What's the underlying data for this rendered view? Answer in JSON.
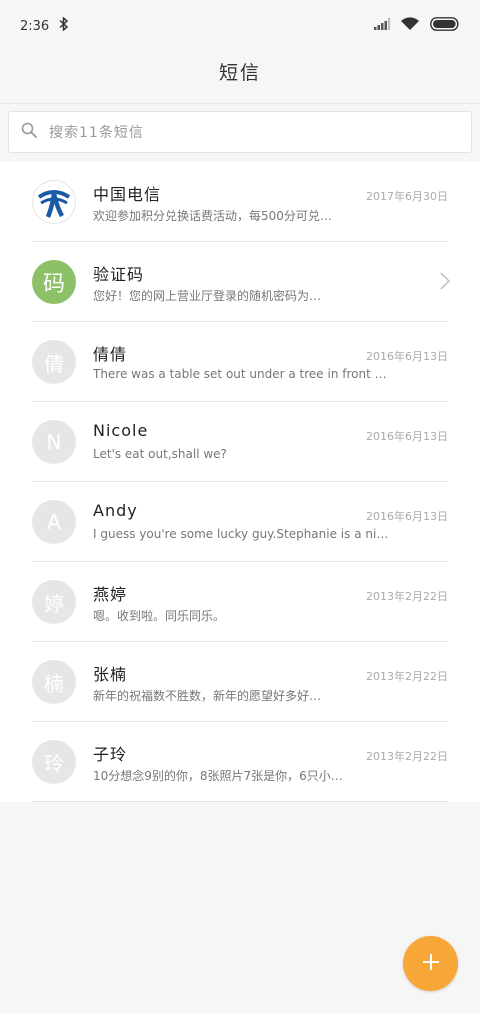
{
  "status_bar": {
    "time": "2:36"
  },
  "header": {
    "title": "短信"
  },
  "search": {
    "placeholder": "搜索11条短信"
  },
  "colors": {
    "accent": "#f7a737",
    "avatar_green": "#8cc167",
    "avatar_grey": "#e6e6e6"
  },
  "messages": [
    {
      "name": "中国电信",
      "date": "2017年6月30日",
      "preview": "欢迎参加积分兑换话费活动，每500分可兑…",
      "avatar": "china-telecom-logo"
    },
    {
      "name": "验证码",
      "date": "",
      "preview": "您好！您的网上营业厅登录的随机密码为…",
      "avatar_text": "码"
    },
    {
      "name": "倩倩",
      "date": "2016年6月13日",
      "preview": "There was a table set out under a tree in front o…",
      "avatar_text": "倩"
    },
    {
      "name": "Nicole",
      "date": "2016年6月13日",
      "preview": "Let's eat out,shall we?",
      "avatar_text": "N"
    },
    {
      "name": "Andy",
      "date": "2016年6月13日",
      "preview": "I guess you're some lucky guy.Stephanie is a nice…",
      "avatar_text": "A"
    },
    {
      "name": "燕婷",
      "date": "2013年2月22日",
      "preview": "嗯。收到啦。同乐同乐。",
      "avatar_text": "婷"
    },
    {
      "name": "张楠",
      "date": "2013年2月22日",
      "preview": "新年的祝福数不胜数，新年的愿望好多好…",
      "avatar_text": "楠"
    },
    {
      "name": "子玲",
      "date": "2013年2月22日",
      "preview": "10分想念9别的你，8张照片7张是你，6只小…",
      "avatar_text": "玲"
    }
  ],
  "fab": {
    "icon": "plus-icon"
  }
}
